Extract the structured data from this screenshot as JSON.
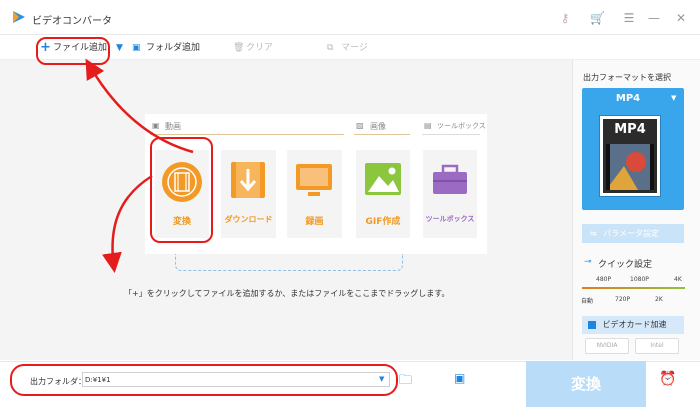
{
  "app": {
    "title": "ビデオコンバータ"
  },
  "toolbar": {
    "add_file": "ファイル追加",
    "add_folder": "フォルダ追加",
    "clear": "クリア",
    "merge": "マージ"
  },
  "sections": {
    "video": "動画",
    "image": "画像",
    "toolbox": "ツールボックス"
  },
  "tiles": [
    {
      "label": "変換"
    },
    {
      "label": "ダウンロード"
    },
    {
      "label": "録画"
    },
    {
      "label": "GIF作成"
    },
    {
      "label": "ツールボックス"
    }
  ],
  "hint": "「+」をクリックしてファイルを追加するか、またはファイルをここまでドラッグします。",
  "bottom": {
    "output_label": "出力フォルダ：",
    "output_path": "D:¥1¥1",
    "convert": "変換"
  },
  "sidebar": {
    "title": "出力フォーマットを選択",
    "format": "MP4",
    "format_badge": "MP4",
    "params": "パラメータ設定",
    "quick_settings": "クイック設定",
    "scale_top": [
      "480P",
      "1080P",
      "4K"
    ],
    "scale_bottom": [
      "自動",
      "720P",
      "2K"
    ],
    "gpu": "ビデオカード加速",
    "chips": [
      "NVIDIA",
      "Intel"
    ]
  },
  "colors": {
    "accent": "#39a6ec",
    "orange": "#f09a25",
    "annotation": "#e51c1c"
  }
}
